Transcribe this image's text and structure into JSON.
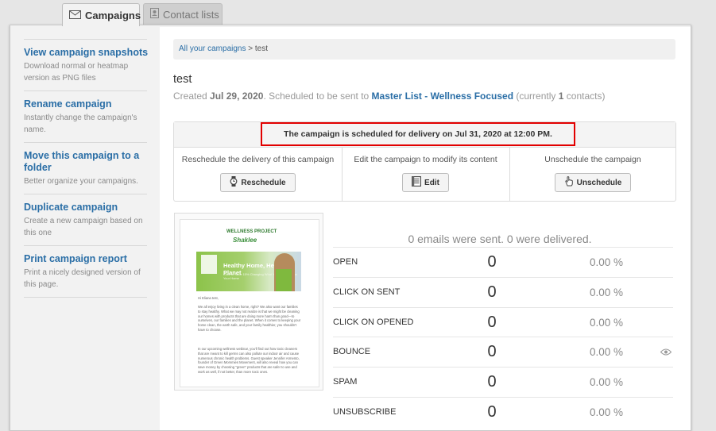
{
  "tabs": [
    {
      "label": "Campaigns",
      "icon": "envelope-icon",
      "active": true
    },
    {
      "label": "Contact lists",
      "icon": "contact-book-icon",
      "active": false
    }
  ],
  "sidebar": {
    "items": [
      {
        "title": "View campaign snapshots",
        "desc": "Download normal or heatmap version as PNG files"
      },
      {
        "title": "Rename campaign",
        "desc": "Instantly change the campaign's name."
      },
      {
        "title": "Move this campaign to a folder",
        "desc": "Better organize your campaigns."
      },
      {
        "title": "Duplicate campaign",
        "desc": "Create a new campaign based on this one"
      },
      {
        "title": "Print campaign report",
        "desc": "Print a nicely designed version of this page."
      }
    ]
  },
  "breadcrumb": {
    "root": "All your campaigns",
    "sep": ">",
    "current": "test"
  },
  "campaign": {
    "name": "test",
    "created_prefix": "Created",
    "created_date": "Jul 29, 2020",
    "scheduled_text": ". Scheduled to be sent to",
    "list_name": "Master List - Wellness Focused",
    "contacts_prefix": "(currently",
    "contacts_count": "1",
    "contacts_suffix": "contacts)"
  },
  "schedule": {
    "message": "The campaign is scheduled for delivery on Jul 31, 2020 at 12:00 PM.",
    "actions": [
      {
        "label": "Reschedule the delivery of this campaign",
        "button": "Reschedule",
        "icon": "watch-icon"
      },
      {
        "label": "Edit the campaign to modify its content",
        "button": "Edit",
        "icon": "document-edit-icon"
      },
      {
        "label": "Unschedule the campaign",
        "button": "Unschedule",
        "icon": "hand-pointer-icon"
      }
    ]
  },
  "preview": {
    "brand_top": "WELLNESS PROJECT",
    "brand": "Shaklee",
    "hero_title": "Healthy Home, Healthy Planet",
    "hero_sub": "Click to Save 15% Changing What You Use to Clean Your Home",
    "greeting": "Hi Eliana test,",
    "para1": "We all enjoy living in a clean home, right? We also want our families to stay healthy. What we may not realize is that we might be cleaning our homes with products that are doing more harm than good—to ourselves, our families and the planet. When it comes to keeping your home clean, the earth safe, and your family healthier, you shouldn't have to choose.",
    "para2": "In our upcoming wellness webinar, you'll find out how toxic cleaners that are meant to kill germs can also pollute our indoor air and cause numerous chronic health problems. Guest speaker Jennifer Armento, founder of Green Mommies Movement, will also reveal how you can save money by choosing \"green\" products that are safer to use and work as well, if not better, than more toxic ones."
  },
  "stats": {
    "summary": "0 emails were sent. 0 were delivered.",
    "rows": [
      {
        "name": "OPEN",
        "value": "0",
        "percent": "0.00 %"
      },
      {
        "name": "CLICK ON SENT",
        "value": "0",
        "percent": "0.00 %"
      },
      {
        "name": "CLICK ON OPENED",
        "value": "0",
        "percent": "0.00 %"
      },
      {
        "name": "BOUNCE",
        "value": "0",
        "percent": "0.00 %",
        "icon": "eye-icon"
      },
      {
        "name": "SPAM",
        "value": "0",
        "percent": "0.00 %"
      },
      {
        "name": "UNSUBSCRIBE",
        "value": "0",
        "percent": "0.00 %"
      }
    ]
  },
  "colors": {
    "link": "#2a6ea6",
    "highlight_border": "#e20000"
  }
}
